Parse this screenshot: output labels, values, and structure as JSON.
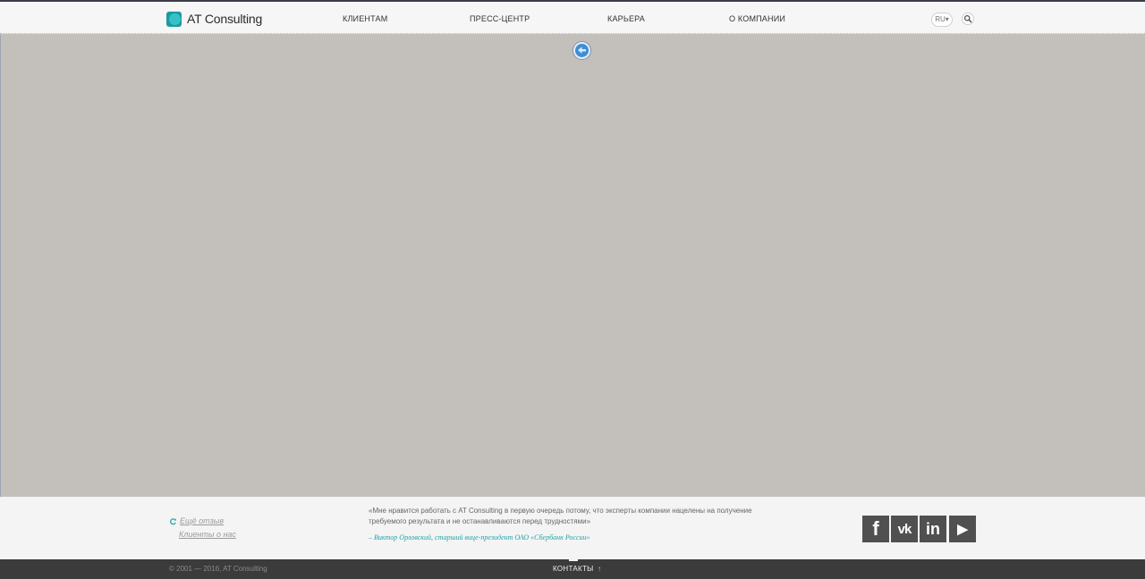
{
  "header": {
    "logo_text": "AT Consulting",
    "nav": [
      {
        "label": "КЛИЕНТАМ"
      },
      {
        "label": "ПРЕСС-ЦЕНТР"
      },
      {
        "label": "КАРЬЕРА"
      },
      {
        "label": "О КОМПАНИИ"
      }
    ],
    "language": "RU▾"
  },
  "footer": {
    "more_review": "Ещё отзыв",
    "clients_about_us": "Клиенты о нас",
    "quote": "«Мне нравится работать с AT Consulting в первую очередь потому, что эксперты компании нацелены на получение требуемого результата и не останавливаются перед трудностями»",
    "quote_author": "– Виктор Орловский, старший вице-президент ОАО «Сбербанк России»",
    "social": [
      {
        "icon": "facebook-icon",
        "glyph": "f"
      },
      {
        "icon": "vk-icon",
        "glyph": "vk"
      },
      {
        "icon": "linkedin-icon",
        "glyph": "in"
      },
      {
        "icon": "youtube-icon",
        "glyph": "▶"
      }
    ]
  },
  "bottom_bar": {
    "copyright": "© 2001 — 2016, AT Consulting",
    "contacts": "КОНТАКТЫ",
    "contacts_arrow": "↑"
  },
  "colors": {
    "accent": "#23a2a6",
    "map_bg": "#c3bfbb",
    "dark_bar": "#3b3b3b"
  }
}
